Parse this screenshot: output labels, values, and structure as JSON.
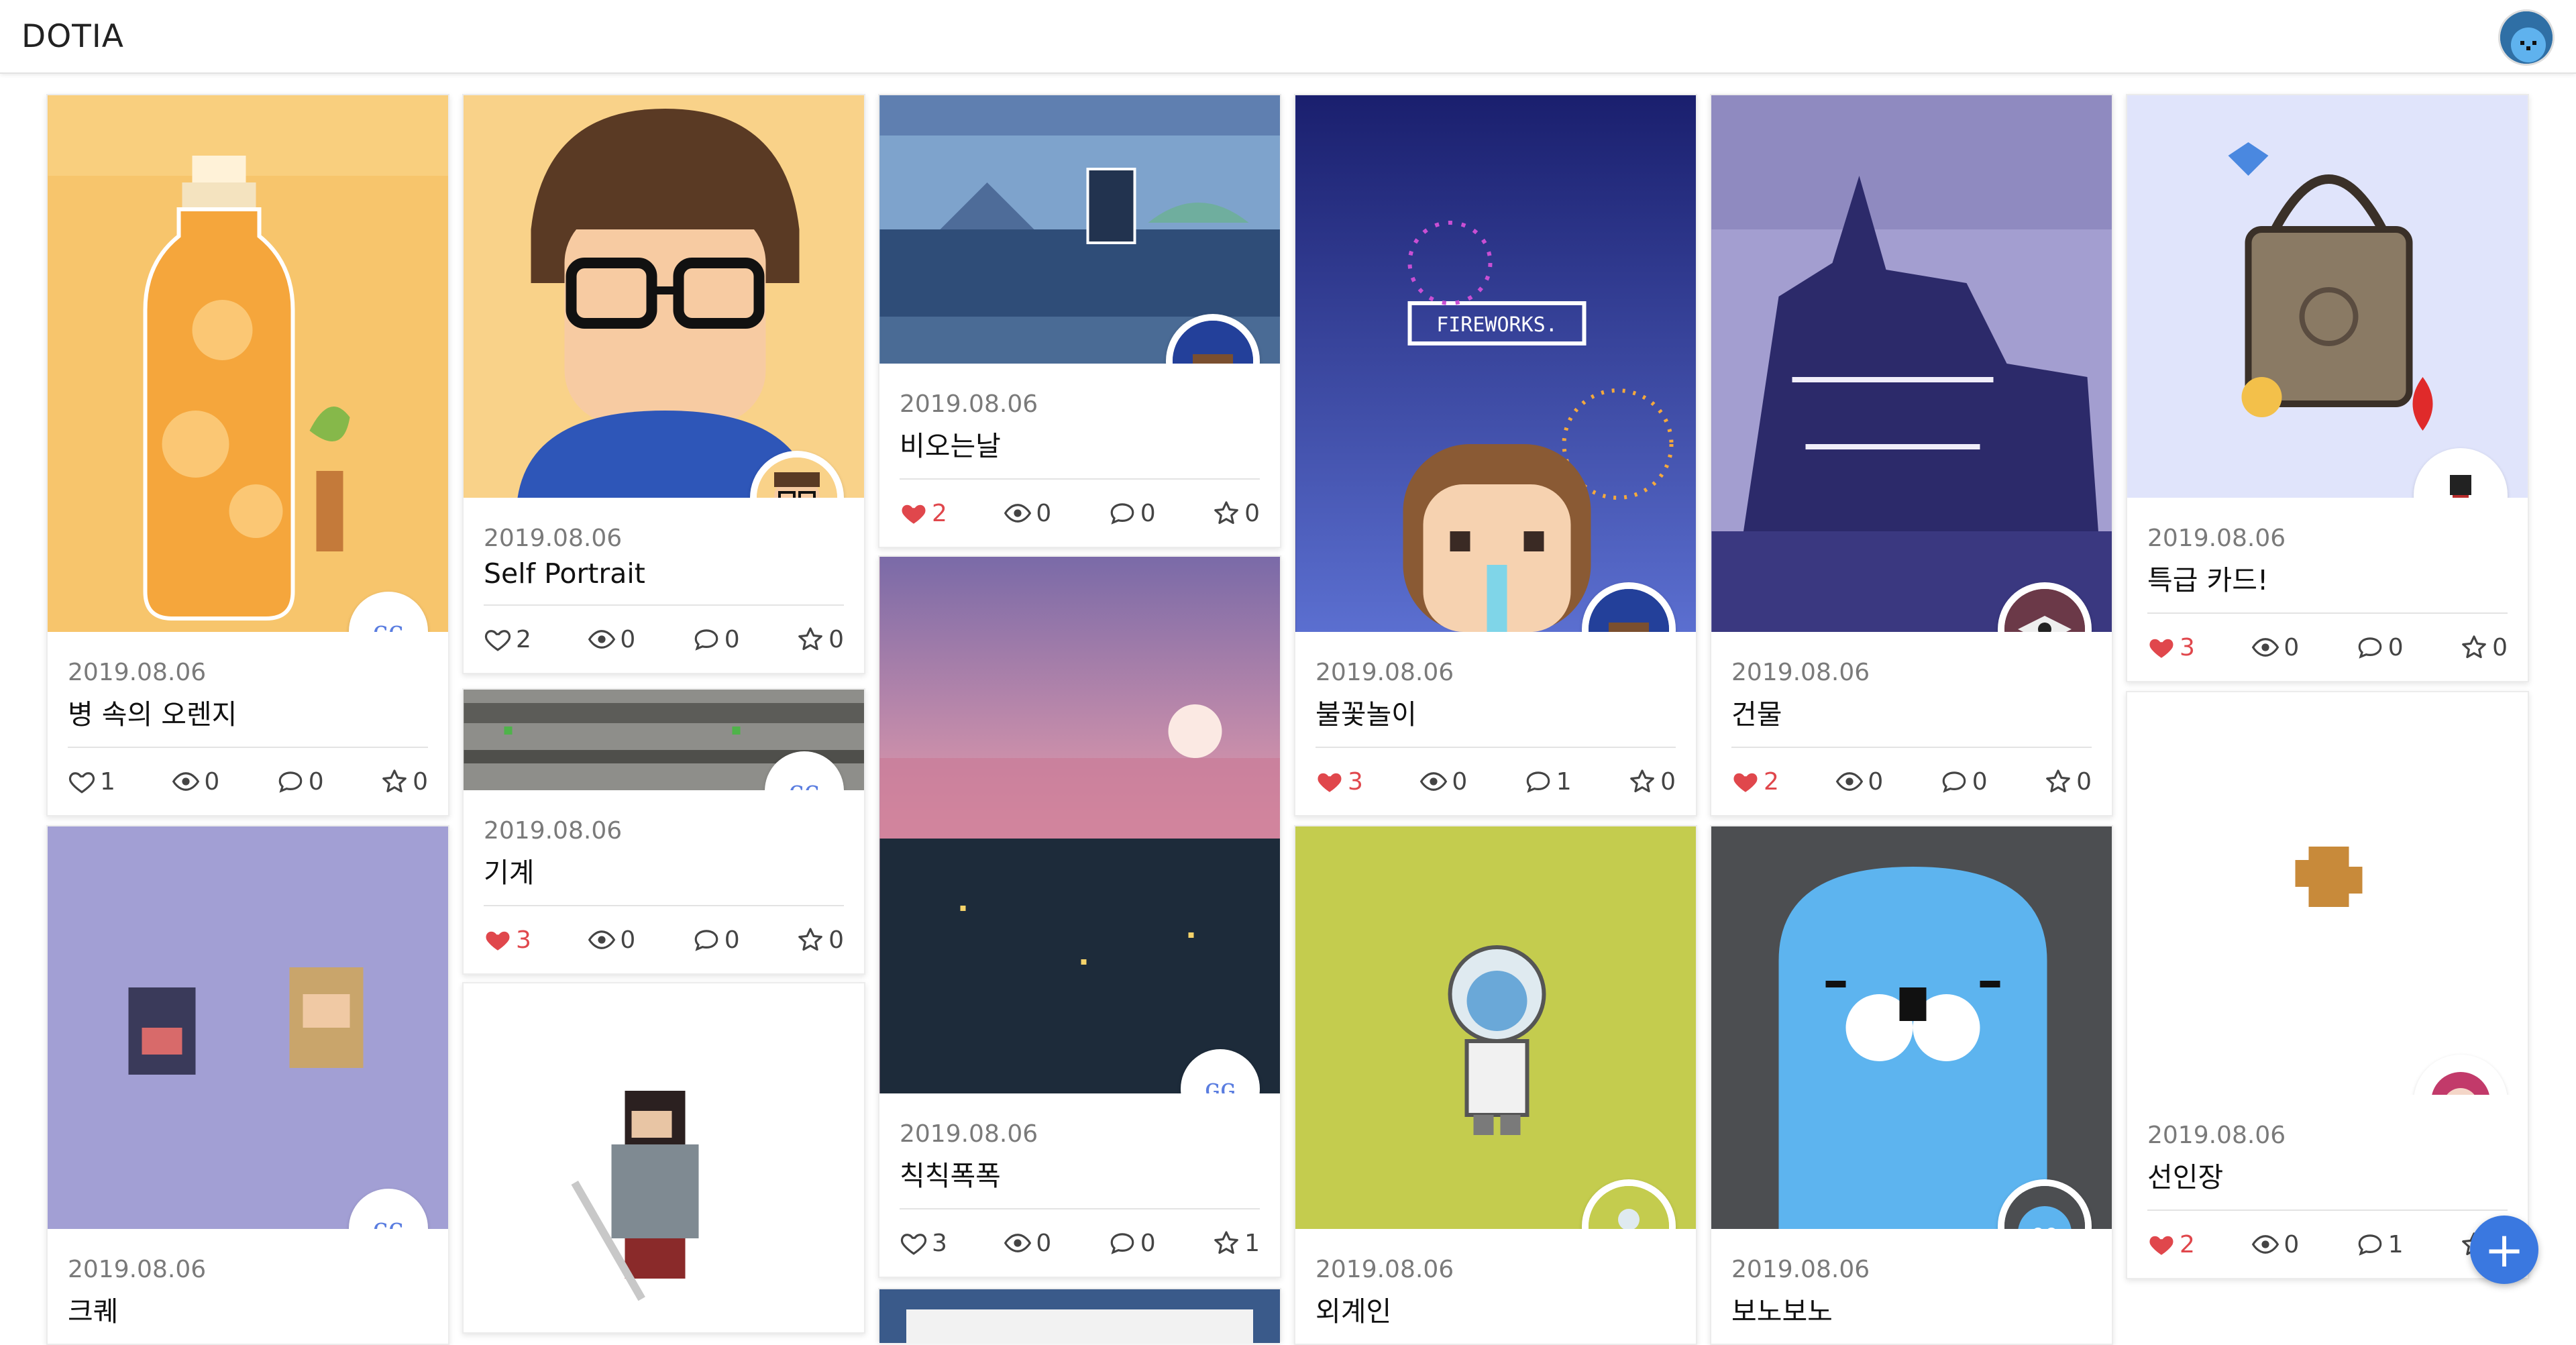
{
  "app": {
    "brand": "DOTIA"
  },
  "colors": {
    "accent": "#3a78e0",
    "like": "#e0474c"
  },
  "cards": [
    {
      "date": "2019.08.06",
      "title": "병 속의 오렌지",
      "likes": "1",
      "views": "0",
      "comments": "0",
      "stars": "0",
      "liked": false
    },
    {
      "date": "2019.08.06",
      "title": "Self Portrait",
      "likes": "2",
      "views": "0",
      "comments": "0",
      "stars": "0",
      "liked": false
    },
    {
      "date": "2019.08.06",
      "title": "비오는날",
      "likes": "2",
      "views": "0",
      "comments": "0",
      "stars": "0",
      "liked": true
    },
    {
      "date": "2019.08.06",
      "title": "불꽃놀이",
      "likes": "3",
      "views": "0",
      "comments": "1",
      "stars": "0",
      "liked": true
    },
    {
      "date": "2019.08.06",
      "title": "건물",
      "likes": "2",
      "views": "0",
      "comments": "0",
      "stars": "0",
      "liked": true
    },
    {
      "date": "2019.08.06",
      "title": "특급 카드!",
      "likes": "3",
      "views": "0",
      "comments": "0",
      "stars": "0",
      "liked": true
    },
    {
      "date": "2019.08.06",
      "title": "기계",
      "likes": "3",
      "views": "0",
      "comments": "0",
      "stars": "0",
      "liked": true
    },
    {
      "date": "2019.08.06",
      "title": "칙칙폭폭",
      "likes": "3",
      "views": "0",
      "comments": "0",
      "stars": "1",
      "liked": false
    },
    {
      "date": "2019.08.06",
      "title": "선인장",
      "likes": "2",
      "views": "0",
      "comments": "1",
      "stars": "0",
      "liked": true
    },
    {
      "date": "2019.08.06",
      "title": "크퀘"
    },
    {
      "date": "2019.08.06",
      "title": "외계인"
    },
    {
      "date": "2019.08.06",
      "title": "보노보노"
    }
  ],
  "fab": {
    "label": "+"
  },
  "icons": {
    "like": "heart-icon",
    "views": "eye-icon",
    "comments": "comment-icon",
    "stars": "star-icon",
    "fab": "plus-icon"
  }
}
